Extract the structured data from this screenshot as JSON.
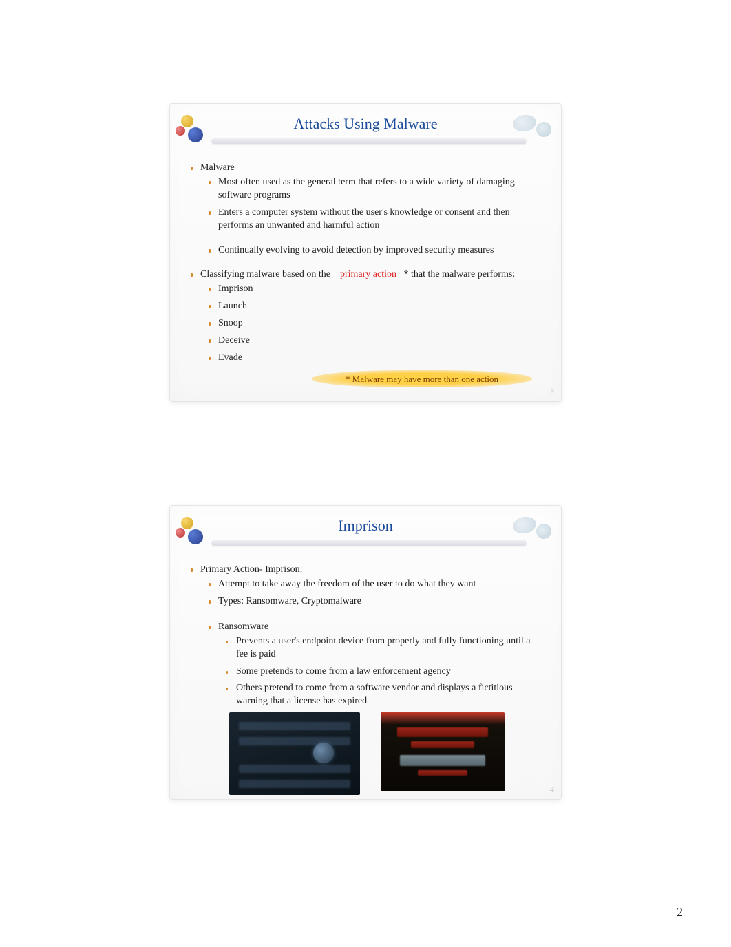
{
  "page_number": "2",
  "slide1": {
    "title": "Attacks Using Malware",
    "slide_number": "3",
    "b1": "Malware",
    "b1_subs": {
      "a": "Most often used as the general term that refers to a wide variety of damaging software programs",
      "b": "Enters a computer system without the user's knowledge or consent and then performs an unwanted and harmful action",
      "c": "Continually evolving to avoid detection by improved security measures"
    },
    "b2_pre": "Classifying malware based on the ",
    "b2_red": "primary action",
    "b2_post": " * that the malware performs:",
    "b2_subs": {
      "a": "Imprison",
      "b": "Launch",
      "c": "Snoop",
      "d": "Deceive",
      "e": "Evade"
    },
    "note": "* Malware may have more than one action"
  },
  "slide2": {
    "title": "Imprison",
    "slide_number": "4",
    "b1": "Primary Action- Imprison:",
    "b1_subs": {
      "a": "Attempt to take away the freedom of the user to do what they want",
      "b": "Types: Ransomware, Cryptomalware"
    },
    "b2": "Ransomware",
    "b2_subs": {
      "a": "Prevents a user's endpoint device from properly and fully functioning until a fee is paid",
      "b": "Some pretends to come from a law enforcement agency",
      "c": "Others pretend to come from a software vendor and displays a fictitious warning that a license has expired"
    }
  }
}
